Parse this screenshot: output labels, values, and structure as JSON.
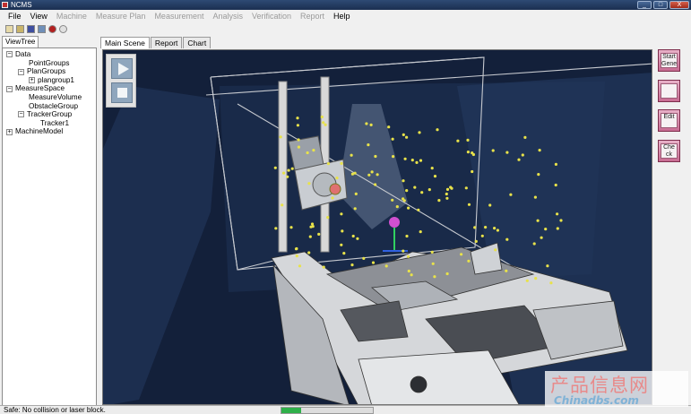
{
  "window": {
    "title": "NCMS",
    "controls": [
      "_",
      "□",
      "X"
    ]
  },
  "menu": [
    {
      "label": "File",
      "enabled": true
    },
    {
      "label": "View",
      "enabled": true
    },
    {
      "label": "Machine",
      "enabled": false
    },
    {
      "label": "Measure Plan",
      "enabled": false
    },
    {
      "label": "Measurement",
      "enabled": false
    },
    {
      "label": "Analysis",
      "enabled": false
    },
    {
      "label": "Verification",
      "enabled": false
    },
    {
      "label": "Report",
      "enabled": false
    },
    {
      "label": "Help",
      "enabled": true
    }
  ],
  "toolbar": {
    "icons": [
      "open-icon",
      "open-folder-icon",
      "save-icon",
      "database-icon",
      "record-icon",
      "search-icon"
    ]
  },
  "left_panel": {
    "tab": "ViewTree",
    "tree": [
      {
        "label": "Data",
        "depth": 0,
        "expander": "−"
      },
      {
        "label": "PointGroups",
        "depth": 1,
        "expander": ""
      },
      {
        "label": "PlanGroups",
        "depth": 1,
        "expander": "−"
      },
      {
        "label": "plangroup1",
        "depth": 2,
        "expander": "+"
      },
      {
        "label": "MeasureSpace",
        "depth": 0,
        "expander": "−"
      },
      {
        "label": "MeasureVolume",
        "depth": 1,
        "expander": ""
      },
      {
        "label": "ObstacleGroup",
        "depth": 1,
        "expander": ""
      },
      {
        "label": "TrackerGroup",
        "depth": 1,
        "expander": "−"
      },
      {
        "label": "Tracker1",
        "depth": 2,
        "expander": ""
      },
      {
        "label": "MachineModel",
        "depth": 0,
        "expander": "+"
      }
    ]
  },
  "main_tabs": [
    {
      "label": "Main Scene",
      "active": true
    },
    {
      "label": "Report",
      "active": false
    },
    {
      "label": "Chart",
      "active": false
    }
  ],
  "scene_controls": {
    "play_icon": "play-icon",
    "stop_icon": "stop-icon"
  },
  "right_buttons": [
    {
      "label": "Start Gene",
      "icon": "start-icon"
    },
    {
      "label": "",
      "icon": "view-icon"
    },
    {
      "label": "Edit",
      "icon": "edit-icon"
    },
    {
      "label": "Che ck",
      "icon": "check-icon"
    }
  ],
  "status": {
    "text": "Safe: No collision or laser block.",
    "progress": 0.22
  },
  "watermark": {
    "line1": "产品信息网",
    "line2": "Chinadbs.com"
  },
  "colors": {
    "scene_bg": "#13203a",
    "point": "#e8e24a",
    "probe": "#d050d0",
    "progress": "#2fb04a",
    "titlebar": "#1b2f50"
  }
}
